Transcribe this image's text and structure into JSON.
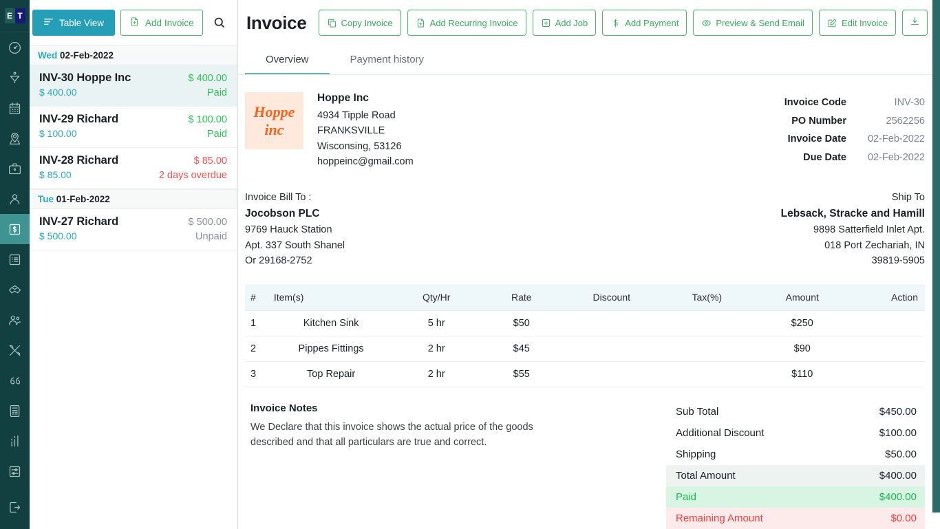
{
  "rail": {
    "logo": {
      "left": "E",
      "right": "T",
      "name": "et-logo"
    },
    "items": [
      {
        "name": "dashboard",
        "icon": "gauge-icon"
      },
      {
        "name": "leads",
        "icon": "funnel-icon"
      },
      {
        "name": "calendar",
        "icon": "calendar-icon"
      },
      {
        "name": "map",
        "icon": "map-pin-icon"
      },
      {
        "name": "jobs",
        "icon": "briefcase-icon"
      },
      {
        "name": "customers",
        "icon": "user-icon"
      },
      {
        "name": "invoices",
        "icon": "dollar-icon"
      },
      {
        "name": "estimates",
        "icon": "list-icon"
      },
      {
        "name": "partners",
        "icon": "handshake-icon"
      },
      {
        "name": "team",
        "icon": "users-icon"
      },
      {
        "name": "tools",
        "icon": "tools-icon"
      },
      {
        "name": "reviews",
        "icon": "quote-icon"
      },
      {
        "name": "reports",
        "icon": "document-icon"
      },
      {
        "name": "analytics",
        "icon": "bar-chart-icon"
      },
      {
        "name": "settings",
        "icon": "sliders-icon"
      },
      {
        "name": "logout",
        "icon": "logout-icon"
      }
    ]
  },
  "list_panel": {
    "table_view_label": "Table View",
    "add_invoice_label": "Add Invoice",
    "search_icon": "search-icon",
    "groups": [
      {
        "dow": "Wed",
        "date": "02-Feb-2022",
        "rows": [
          {
            "code_name": "INV-30 Hoppe Inc",
            "amount": "$ 400.00",
            "amount_state": "green",
            "paid_amount": "$ 400.00",
            "status": "Paid",
            "status_state": "green",
            "selected": true
          },
          {
            "code_name": "INV-29 Richard",
            "amount": "$ 100.00",
            "amount_state": "green",
            "paid_amount": "$ 100.00",
            "status": "Paid",
            "status_state": "green",
            "selected": false
          },
          {
            "code_name": "INV-28 Richard",
            "amount": "$ 85.00",
            "amount_state": "red",
            "paid_amount": "$ 85.00",
            "status": "2 days overdue",
            "status_state": "red",
            "selected": false
          }
        ]
      },
      {
        "dow": "Tue",
        "date": "01-Feb-2022",
        "rows": [
          {
            "code_name": "INV-27 Richard",
            "amount": "$ 500.00",
            "amount_state": "gray",
            "paid_amount": "$ 500.00",
            "status": "Unpaid",
            "status_state": "gray",
            "selected": false
          }
        ]
      }
    ]
  },
  "main": {
    "title": "Invoice",
    "toolbar": [
      {
        "label": "Copy Invoice",
        "icon": "copy-icon",
        "name": "copy-invoice-button"
      },
      {
        "label": "Add Recurring Invoice",
        "icon": "file-plus-icon",
        "name": "add-recurring-invoice-button"
      },
      {
        "label": "Add Job",
        "icon": "plus-square-icon",
        "name": "add-job-button"
      },
      {
        "label": "Add Payment",
        "icon": "dollar-icon",
        "name": "add-payment-button"
      },
      {
        "label": "Preview & Send Email",
        "icon": "eye-icon",
        "name": "preview-send-email-button"
      },
      {
        "label": "Edit Invoice",
        "icon": "pencil-square-icon",
        "name": "edit-invoice-button"
      }
    ],
    "download_icon": "download-icon",
    "delete_icon": "trash-icon",
    "tabs": [
      {
        "label": "Overview",
        "active": true
      },
      {
        "label": "Payment history",
        "active": false
      }
    ],
    "org": {
      "logo_line1": "Hoppe",
      "logo_line2": "inc",
      "name": "Hoppe Inc",
      "lines": [
        "4934 Tipple Road",
        "FRANKSVILLE",
        "Wisconsing, 53126",
        "hoppeinc@gmail.com"
      ]
    },
    "meta": [
      {
        "key": "Invoice Code",
        "value": "INV-30"
      },
      {
        "key": "PO Number",
        "value": "2562256"
      },
      {
        "key": "Invoice Date",
        "value": "02-Feb-2022"
      },
      {
        "key": "Due Date",
        "value": "02-Feb-2022"
      }
    ],
    "bill_to": {
      "label": "Invoice Bill To :",
      "name": "Jocobson PLC",
      "lines": [
        "9769 Hauck Station",
        "Apt. 337 South Shanel",
        "Or 29168-2752"
      ]
    },
    "ship_to": {
      "label": "Ship To",
      "name": "Lebsack, Stracke and Hamill",
      "lines": [
        "9898 Satterfield Inlet Apt.",
        "018 Port Zechariah, IN",
        "39819-5905"
      ]
    },
    "items_table": {
      "headers": [
        "#",
        "Item(s)",
        "Qty/Hr",
        "Rate",
        "Discount",
        "Tax(%)",
        "Amount",
        "Action"
      ],
      "rows": [
        {
          "idx": "1",
          "item": "Kitchen Sink",
          "qty": "5 hr",
          "rate": "$50",
          "discount": "",
          "tax": "",
          "amount": "$250",
          "action": ""
        },
        {
          "idx": "2",
          "item": "Pippes Fittings",
          "qty": "2 hr",
          "rate": "$45",
          "discount": "",
          "tax": "",
          "amount": "$90",
          "action": ""
        },
        {
          "idx": "3",
          "item": "Top Repair",
          "qty": "2 hr",
          "rate": "$55",
          "discount": "",
          "tax": "",
          "amount": "$110",
          "action": ""
        }
      ]
    },
    "notes": {
      "title": "Invoice Notes",
      "body": "We Declare that this invoice shows the actual price of the goods described and that all particulars are true and correct."
    },
    "totals": [
      {
        "key": "Sub Total",
        "value": "$450.00",
        "style": "plain"
      },
      {
        "key": "Additional Discount",
        "value": "$100.00",
        "style": "plain"
      },
      {
        "key": "Shipping",
        "value": "$50.00",
        "style": "plain"
      },
      {
        "key": "Total Amount",
        "value": "$400.00",
        "style": "hl-total"
      },
      {
        "key": "Paid",
        "value": "$400.00",
        "style": "hl-paid"
      },
      {
        "key": "Remaining Amount",
        "value": "$0.00",
        "style": "hl-rem"
      }
    ]
  },
  "colors": {
    "rail_bg": "#123f3f",
    "rail_active": "#3f9492",
    "teal_btn": "#259fb8",
    "green_accent": "#3aab5c",
    "status_green": "#2bc255",
    "status_red": "#fa5252",
    "status_gray": "#8b9196",
    "logo_orange": "#f4651f",
    "table_head_bg": "#eef8fb"
  }
}
